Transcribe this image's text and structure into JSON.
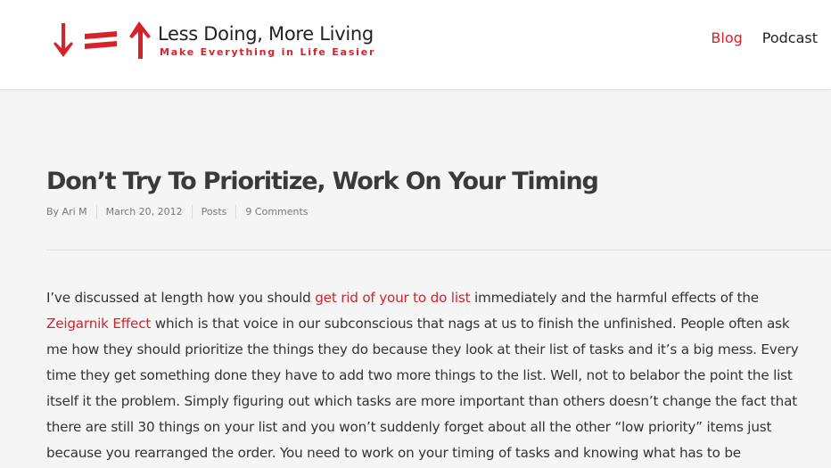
{
  "site": {
    "title": "Less Doing, More Living",
    "tagline": "Make Everything in Life Easier",
    "brand_color": "#d6222a"
  },
  "nav": {
    "items": [
      {
        "label": "Blog",
        "active": true
      },
      {
        "label": "Podcast",
        "active": false
      }
    ]
  },
  "post": {
    "title": "Don’t Try To Prioritize, Work On Your Timing",
    "meta": {
      "author": "By Ari M",
      "date": "March 20, 2012",
      "category": "Posts",
      "comments": "9 Comments"
    },
    "body": {
      "p1": "I’ve discussed at length how you should ",
      "link1": "get rid of your to do list",
      "p2": " immediately and the harmful effects of the ",
      "link2": "Zeigarnik Effect",
      "p3": " which is that voice in our subconscious that nags at us to finish the unfinished. People often ask me how they should prioritize the things they do because they look at their list of tasks and it’s a big mess. Every time they get something done they have to add two more things to the list. Well, not to belabor the point the list itself it the problem. Simply figuring out which tasks are more important than others doesn’t change the fact that there are still 30 things on your list and you won’t suddenly forget about all the other “low priority” items just because you rearranged the order. You need to work on your timing of tasks and knowing what has to be"
    }
  }
}
